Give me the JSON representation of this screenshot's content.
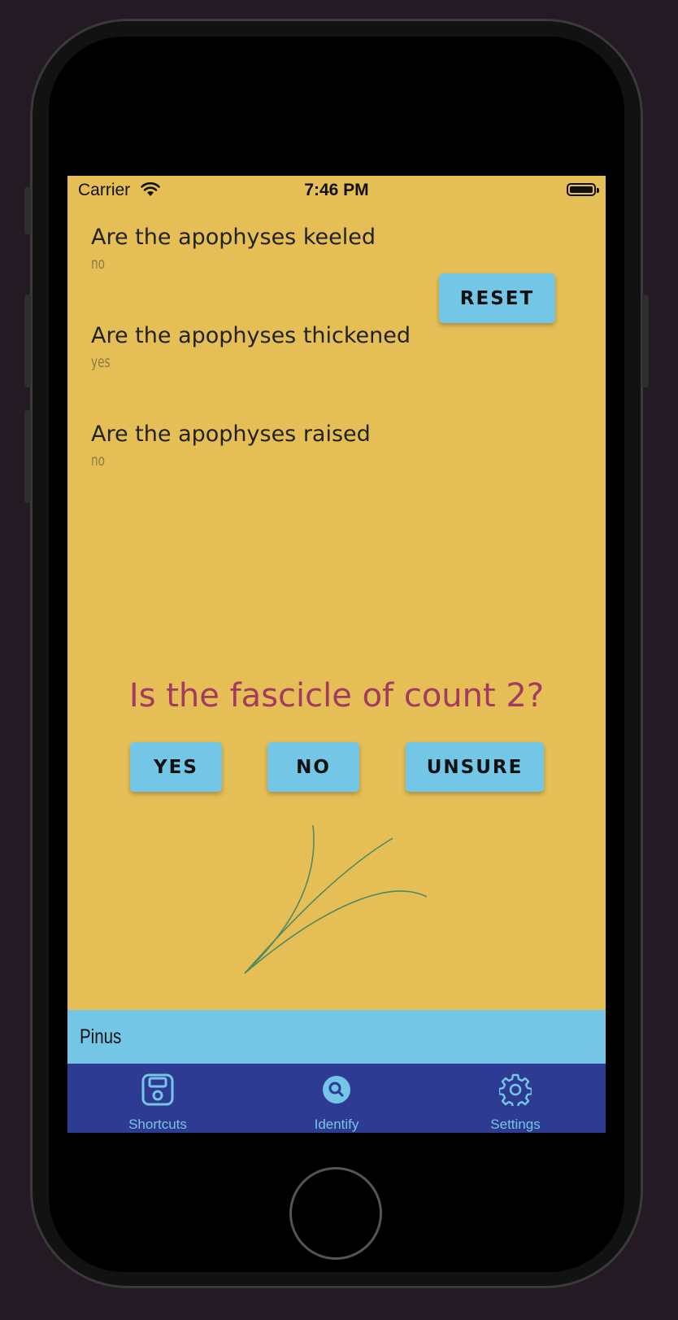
{
  "status": {
    "carrier": "Carrier",
    "time": "7:46 PM"
  },
  "answers": [
    {
      "question": "Are the apophyses keeled",
      "answer": "no"
    },
    {
      "question": "Are the apophyses thickened",
      "answer": "yes"
    },
    {
      "question": "Are the apophyses raised",
      "answer": "no"
    }
  ],
  "reset_label": "RESET",
  "current_question": "Is the fascicle of count 2?",
  "choices": {
    "yes": "YES",
    "no": "NO",
    "unsure": "UNSURE"
  },
  "breadcrumb": "Pinus",
  "tabs": [
    {
      "label": "Shortcuts",
      "icon": "save-icon"
    },
    {
      "label": "Identify",
      "icon": "search-icon"
    },
    {
      "label": "Settings",
      "icon": "gear-icon"
    }
  ],
  "colors": {
    "screen_bg": "#e5bf55",
    "button": "#74c6e6",
    "question": "#a33a62",
    "tabbar": "#2e3b93"
  }
}
